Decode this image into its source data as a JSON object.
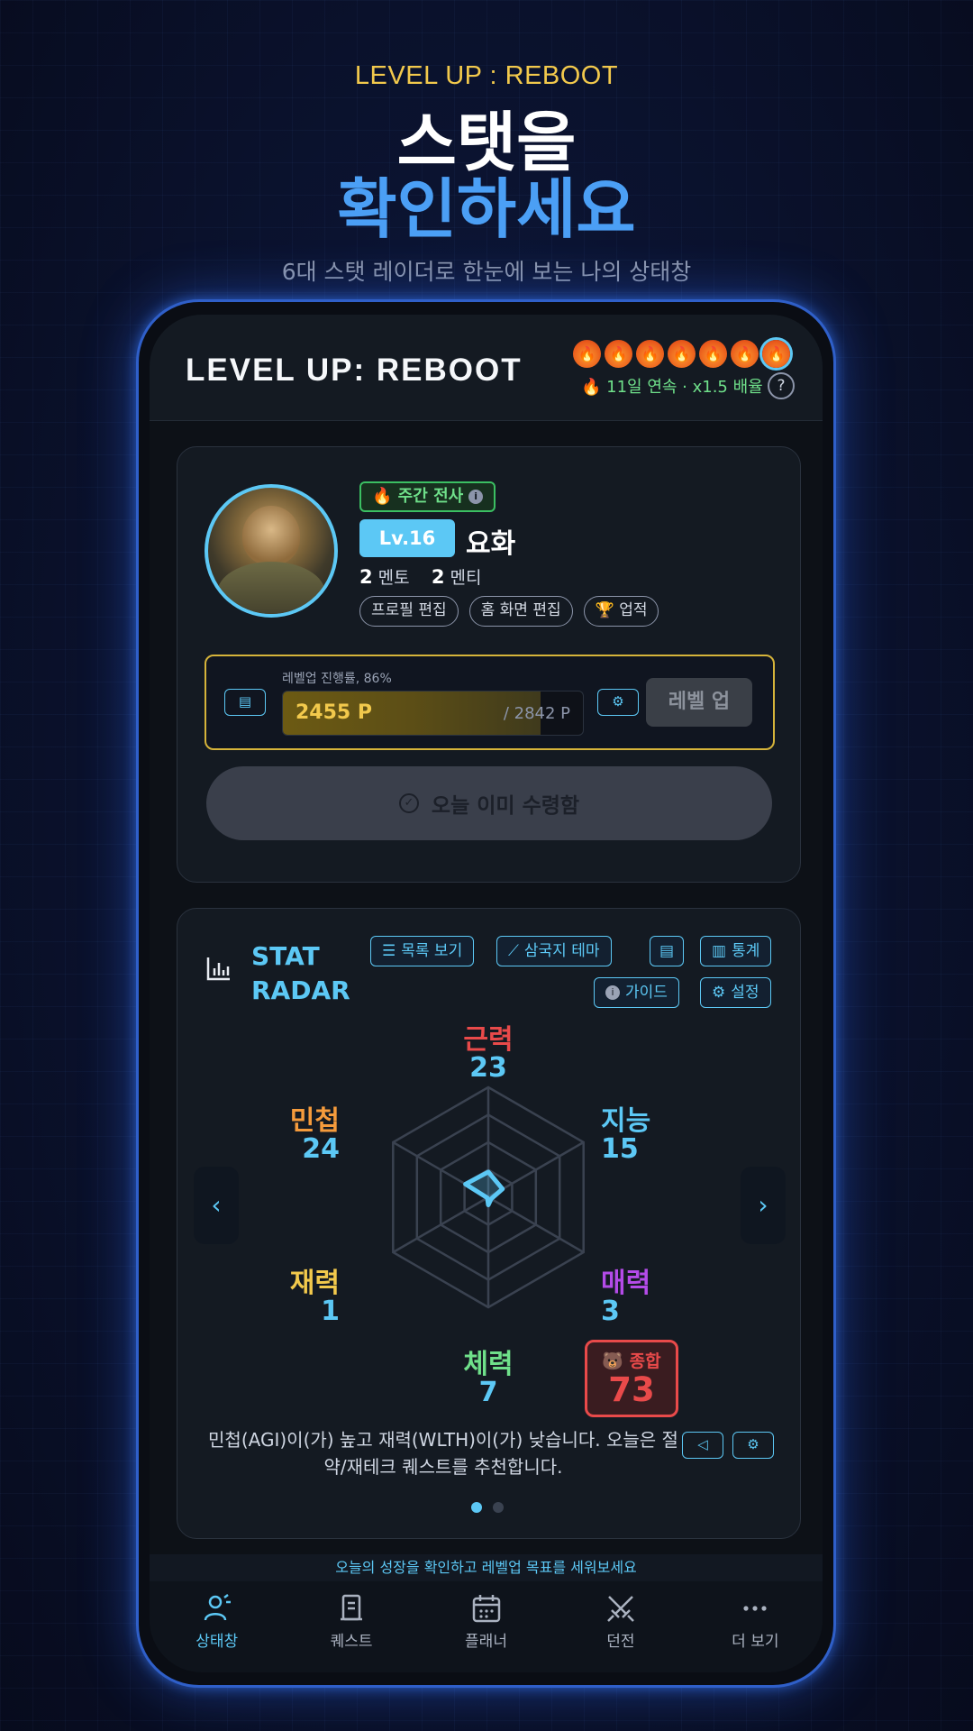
{
  "promo": {
    "kicker": "LEVEL UP : REBOOT",
    "title_line1": "스탯을",
    "title_line2": "확인하세요",
    "subtitle": "6대 스탯 레이더로 한눈에 보는 나의 상태창"
  },
  "appbar": {
    "title": "LEVEL UP: REBOOT",
    "streak_flames": 7,
    "streak_text": "🔥 11일 연속 · x1.5 배율",
    "help": "?"
  },
  "profile": {
    "weekly_badge": "🔥 주간 전사",
    "weekly_info": "i",
    "level": "Lv.16",
    "name": "요화",
    "mentor_count": "2",
    "mentor_label": "멘토",
    "mentee_count": "2",
    "mentee_label": "멘티",
    "actions": [
      "프로필 편집",
      "홈 화면 편집",
      "🏆 업적"
    ]
  },
  "levelup": {
    "progress_label": "레벨업 진행률, 86%",
    "progress_fraction": 0.86,
    "current_points": "2455 P",
    "total_points": "/ 2842 P",
    "button": "레벨 업",
    "claimed_button": "오늘 이미 수령함"
  },
  "radar": {
    "title": "STAT RADAR",
    "tools": [
      "목록 보기",
      "삼국지 테마",
      "통계",
      "가이드",
      "설정"
    ],
    "stats": [
      {
        "name": "근력",
        "value": 23,
        "color": "#e94a4a"
      },
      {
        "name": "지능",
        "value": 15,
        "color": "#5cc8f5"
      },
      {
        "name": "매력",
        "value": 3,
        "color": "#b44be8"
      },
      {
        "name": "체력",
        "value": 7,
        "color": "#6fe08a"
      },
      {
        "name": "재력",
        "value": 1,
        "color": "#f2c94c"
      },
      {
        "name": "민첩",
        "value": 24,
        "color": "#f59b3c"
      }
    ],
    "total_label": "🐻 종합",
    "total_value": "73",
    "recommendation": "민첩(AGI)이(가) 높고 재력(WLTH)이(가) 낮습니다. 오늘은 절약/재테크 퀘스트를 추천합니다.",
    "prev": "‹",
    "next": "›"
  },
  "banner": "오늘의 성장을 확인하고 레벨업 목표를 세워보세요",
  "tabs": [
    {
      "label": "상태창",
      "icon": "profile-icon",
      "active": true
    },
    {
      "label": "퀘스트",
      "icon": "scroll-icon",
      "active": false
    },
    {
      "label": "플래너",
      "icon": "calendar-icon",
      "active": false
    },
    {
      "label": "던전",
      "icon": "swords-icon",
      "active": false
    },
    {
      "label": "더 보기",
      "icon": "more-icon",
      "active": false
    }
  ],
  "colors": {
    "accent": "#5cc8f5",
    "gold": "#f2c94c",
    "danger": "#e94a4a",
    "promo_blue": "#4b9ff5"
  }
}
